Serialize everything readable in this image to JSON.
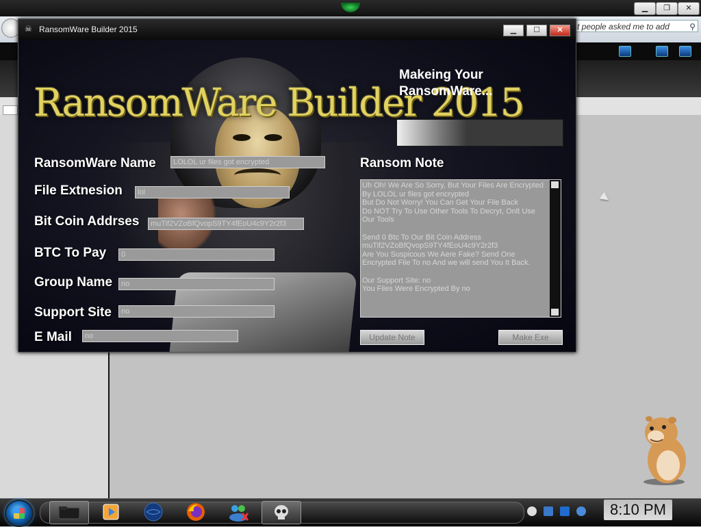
{
  "browser": {
    "search_placeholder": "t people asked me to add"
  },
  "window": {
    "title": "RansomWare Builder 2015",
    "logo_text": "RansomWare Builder 2015",
    "progress_label": "Makeing Your RansomWare...",
    "progress": 0.42
  },
  "form": {
    "ransomware_name": {
      "label": "RansomWare Name",
      "value": "LOLOL ur files got encrypted"
    },
    "file_extension": {
      "label": "File Extnesion",
      "value": "lol"
    },
    "bitcoin_address": {
      "label": "Bit Coin Addrses",
      "value": "muTif2VZoBfQvopS9TY4fEoU4c9Y2r2f3"
    },
    "btc_to_pay": {
      "label": "BTC To Pay",
      "value": "0"
    },
    "group_name": {
      "label": "Group Name",
      "value": "no"
    },
    "support_site": {
      "label": "Support Site",
      "value": "no"
    },
    "email": {
      "label": "E Mail",
      "value": "no"
    }
  },
  "ransom_note": {
    "label": "Ransom Note",
    "text": "Uh Oh! We Are So Sorry, But Your Files Are Encrypted By LOLOL ur files got encrypted\nBut Do Not Worry! You Can Get Your File Back\nDo NOT Try To Use Other Tools To Decryt, Onlt Use Our Tools\n\nSend 0 Btc To Our Bit Coin Address muTif2VZoBfQvopS9TY4fEoU4c9Y2r2f3\nAre You Suspicous We Aere Fake? Send One Encrypted File To no And we will send You It Back.\n\nOur Support Site: no\nYou Files Were Encrypted By no"
  },
  "buttons": {
    "update_note": "Update Note",
    "make_exe": "Make Exe"
  },
  "taskbar": {
    "clock": "8:10 PM"
  },
  "icons": [
    "window-icon",
    "minimize-icon",
    "maximize-icon",
    "close-icon",
    "start-orb-icon",
    "media-player-icon",
    "globe-icon",
    "firefox-icon",
    "messenger-icon",
    "skull-app-icon"
  ]
}
